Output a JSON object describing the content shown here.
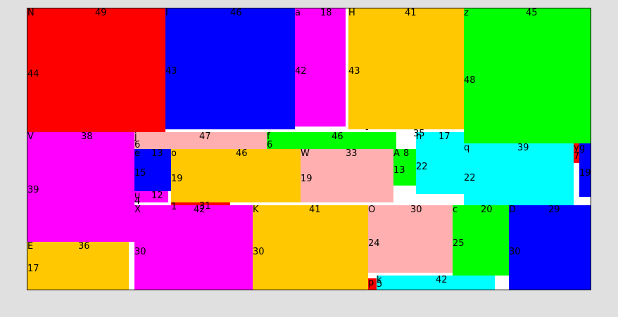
{
  "blocks": [
    {
      "id": "N",
      "name": "N",
      "color": "#ff0000",
      "w_label": "49",
      "h_label": "44"
    },
    {
      "id": "I",
      "name": "I",
      "color": "#0000ff",
      "w_label": "46",
      "h_label": "43"
    },
    {
      "id": "a",
      "name": "a",
      "color": "#ff00ff",
      "w_label": "18",
      "h_label": "42"
    },
    {
      "id": "H",
      "name": "H",
      "color": "#ffc800",
      "w_label": "41",
      "h_label": "43"
    },
    {
      "id": "z",
      "name": "z",
      "color": "#00ff00",
      "w_label": "45",
      "h_label": "48"
    },
    {
      "id": "V",
      "name": "V",
      "color": "#ff00ff",
      "w_label": "38",
      "h_label": "39"
    },
    {
      "id": "j",
      "name": "j",
      "color": "#ffafaf",
      "w_label": "47",
      "h_label": "6"
    },
    {
      "id": "f",
      "name": "f",
      "color": "#00ff00",
      "w_label": "46",
      "h_label": "6"
    },
    {
      "id": "n",
      "name": "n",
      "color": "#00ffff",
      "w_label": "17",
      "h_label": "22"
    },
    {
      "id": "q",
      "name": "q",
      "color": "#00ffff",
      "w_label": "39",
      "h_label": "22"
    },
    {
      "id": "y",
      "name": "y",
      "color": "#ff0000",
      "w_label": "",
      "h_label": "7"
    },
    {
      "id": "gg",
      "name": "g",
      "color": "#0000ff",
      "w_label": "",
      "h_label": "19"
    },
    {
      "id": "e",
      "name": "e",
      "color": "#0000ff",
      "w_label": "13",
      "h_label": "15"
    },
    {
      "id": "o",
      "name": "o",
      "color": "#ffc800",
      "w_label": "46",
      "h_label": "19"
    },
    {
      "id": "W",
      "name": "W",
      "color": "#ffafaf",
      "w_label": "33",
      "h_label": "19"
    },
    {
      "id": "A",
      "name": "A",
      "color": "#00ff00",
      "w_label": "8",
      "h_label": "13"
    },
    {
      "id": "u",
      "name": "u",
      "color": "#ff00ff",
      "w_label": "12",
      "h_label": ""
    },
    {
      "id": "r1",
      "name": "",
      "color": "#ff0000",
      "w_label": "",
      "h_label": ""
    },
    {
      "id": "X",
      "name": "X",
      "color": "#ff00ff",
      "w_label": "42",
      "h_label": "30"
    },
    {
      "id": "K",
      "name": "K",
      "color": "#ffc800",
      "w_label": "41",
      "h_label": "30"
    },
    {
      "id": "O",
      "name": "O",
      "color": "#ffafaf",
      "w_label": "30",
      "h_label": "24"
    },
    {
      "id": "c",
      "name": "c",
      "color": "#00ff00",
      "w_label": "20",
      "h_label": "25"
    },
    {
      "id": "D",
      "name": "D",
      "color": "#0000ff",
      "w_label": "29",
      "h_label": "30"
    },
    {
      "id": "E",
      "name": "E",
      "color": "#ffc800",
      "w_label": "36",
      "h_label": "17"
    },
    {
      "id": "p",
      "name": "p",
      "color": "#ff0000",
      "w_label": "",
      "h_label": ""
    },
    {
      "id": "k",
      "name": "k",
      "color": "#00ffff",
      "w_label": "42",
      "h_label": "5"
    }
  ],
  "extra_labels": [
    {
      "id": "t31",
      "text": "31"
    },
    {
      "id": "t35",
      "text": "35"
    },
    {
      "id": "t1",
      "text": "1"
    },
    {
      "id": "t4",
      "text": "4"
    },
    {
      "id": "tdash",
      "text": "-"
    }
  ]
}
